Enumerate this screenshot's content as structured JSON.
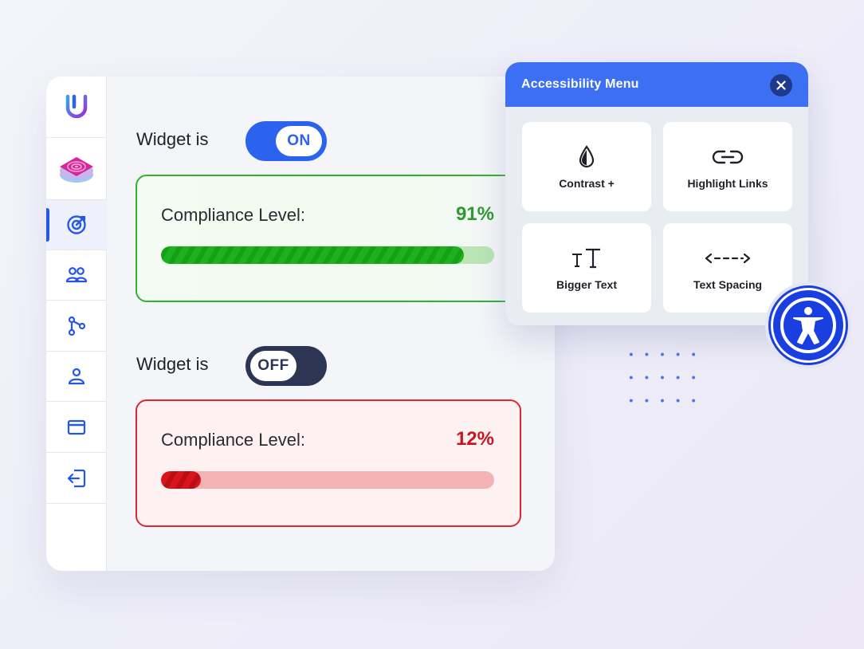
{
  "brand": {
    "logo_icon": "u-logo-icon",
    "accent": "#2c63ee"
  },
  "sidebar": {
    "items": [
      {
        "name": "target-icon",
        "active": true
      },
      {
        "name": "users-icon",
        "active": false
      },
      {
        "name": "share-branch-icon",
        "active": false
      },
      {
        "name": "account-icon",
        "active": false
      },
      {
        "name": "credit-card-icon",
        "active": false
      },
      {
        "name": "logout-icon",
        "active": false
      }
    ]
  },
  "widget_on": {
    "label": "Widget is",
    "toggle_text": "ON",
    "compliance_label": "Compliance Level:",
    "compliance_value": "91%",
    "progress": 0.91,
    "color": "#2fb42f"
  },
  "widget_off": {
    "label": "Widget is",
    "toggle_text": "OFF",
    "compliance_label": "Compliance Level:",
    "compliance_value": "12%",
    "progress": 0.12,
    "color": "#d92a33"
  },
  "a11y_menu": {
    "title": "Accessibility Menu",
    "header_color": "#3d6ff2",
    "tiles": [
      {
        "label": "Contrast +",
        "icon": "droplet-icon"
      },
      {
        "label": "Highlight Links",
        "icon": "link-icon"
      },
      {
        "label": "Bigger Text",
        "icon": "text-size-icon"
      },
      {
        "label": "Text Spacing",
        "icon": "text-spacing-icon"
      }
    ]
  }
}
